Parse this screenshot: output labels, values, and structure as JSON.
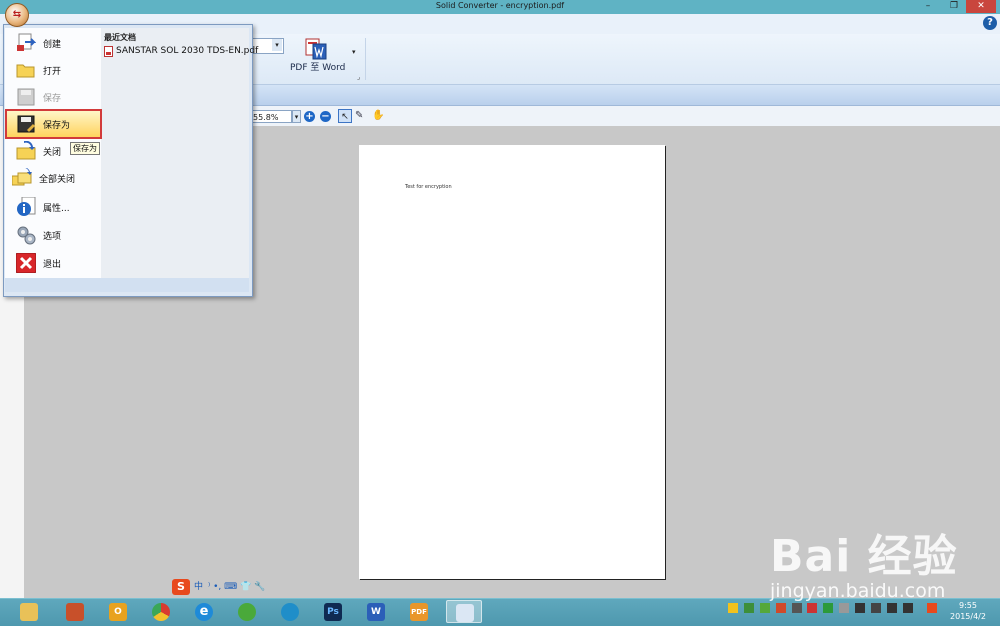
{
  "window": {
    "title": "Solid Converter - encryption.pdf",
    "minimize": "–",
    "restore": "❐",
    "close": "✕"
  },
  "ribbon": {
    "pdf_to_word_label": "PDF 至 Word",
    "dropdown_arrow": "▾",
    "group_launcher": "⌟",
    "help": "?"
  },
  "viewbar": {
    "zoom_value": "55.8%",
    "zoom_in": "+",
    "zoom_out": "−",
    "select_tool": "↖",
    "text_tool": "✎",
    "hand_tool": "✋"
  },
  "document": {
    "page_text": "Test for encryption"
  },
  "app_menu": {
    "items": [
      {
        "label": "创建",
        "enabled": true
      },
      {
        "label": "打开",
        "enabled": true
      },
      {
        "label": "保存",
        "enabled": false
      },
      {
        "label": "保存为",
        "enabled": true,
        "highlighted": true
      },
      {
        "label": "关闭",
        "enabled": true
      },
      {
        "label": "全部关闭",
        "enabled": true
      },
      {
        "label": "属性...",
        "enabled": true
      },
      {
        "label": "选项",
        "enabled": true
      },
      {
        "label": "退出",
        "enabled": true
      }
    ],
    "recent_heading": "最近文档",
    "recent_files": [
      "SANSTAR SOL 2030 TDS-EN.pdf"
    ],
    "tooltip": "保存为"
  },
  "ime": {
    "logo": "S",
    "mode": "中",
    "symbols": "⁾ •, ⌨ 👕 🔧"
  },
  "taskbar": {
    "apps": [
      "file-explorer",
      "toolbox",
      "outlook",
      "chrome",
      "internet-explorer",
      "wechat",
      "browser",
      "photoshop",
      "word",
      "pdf-tool",
      "solid-converter"
    ],
    "app_glyphs": [
      "",
      "",
      "O",
      "",
      "e",
      "",
      "",
      "Ps",
      "W",
      "PDF",
      ""
    ],
    "clock_time": "9:55",
    "clock_date": "2015/4/2"
  },
  "watermark": {
    "logo": "Bai 经验",
    "url": "jingyan.baidu.com"
  },
  "colors": {
    "titlebar": "#5fb3c4",
    "close_button": "#c9463d",
    "highlight_border": "#d23a3a",
    "taskbar": "#4e98ae"
  }
}
